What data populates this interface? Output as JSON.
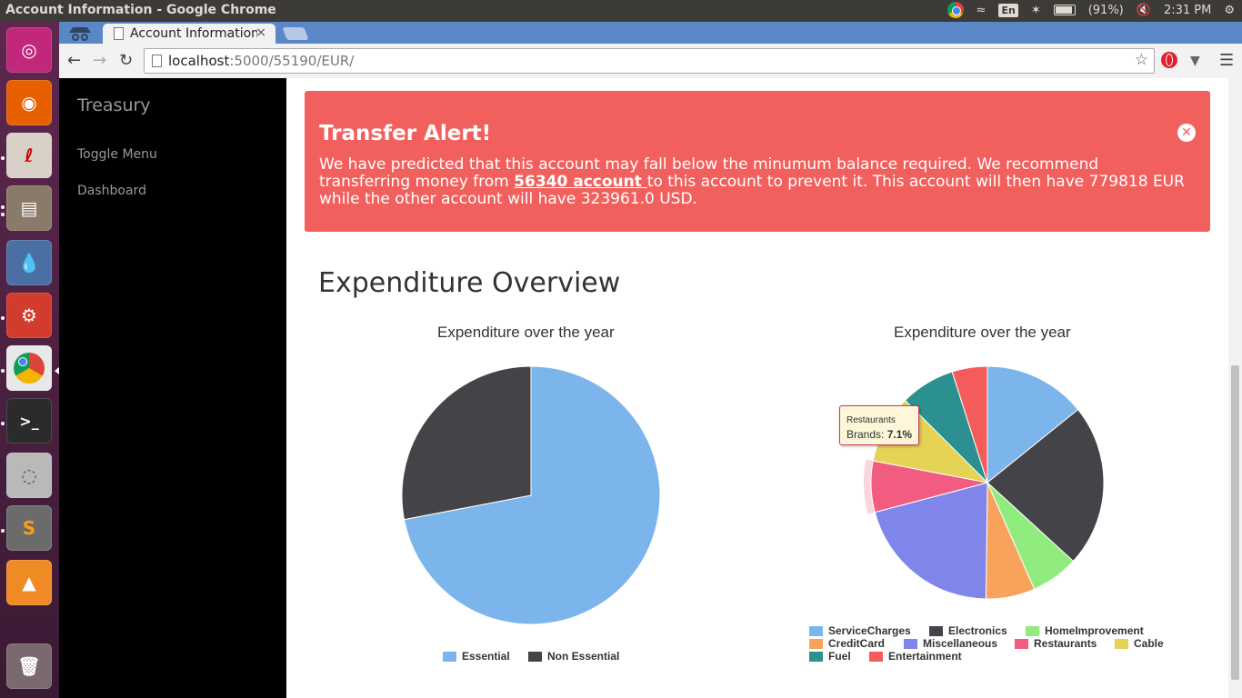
{
  "window": {
    "title": "Account Information - Google Chrome"
  },
  "topbar": {
    "keyboard": "En",
    "battery": "(91%)",
    "clock": "2:31 PM"
  },
  "browser": {
    "tab_title": "Account Information",
    "tab_close": "×",
    "url_host": "localhost",
    "url_rest": ":5000/55190/EUR/"
  },
  "sidebar": {
    "brand": "Treasury",
    "items": [
      {
        "label": "Toggle Menu"
      },
      {
        "label": "Dashboard"
      }
    ]
  },
  "alert": {
    "title": "Transfer Alert!",
    "text_before": "We have predicted that this account may fall below the minumum balance required. We recommend transferring money from ",
    "link": "56340 account ",
    "text_after": "to this account to prevent it. This account will then have 779818 EUR while the other account will have 323961.0 USD.",
    "close": "✕"
  },
  "section": {
    "title": "Expenditure Overview"
  },
  "tooltip": {
    "category": "Restaurants",
    "label": "Brands: ",
    "value": "7.1%"
  },
  "chart_data": [
    {
      "type": "pie",
      "title": "Expenditure over the year",
      "labels": [
        "Essential",
        "Non Essential"
      ],
      "values": [
        72,
        28
      ],
      "colors": [
        "#7cb5ec",
        "#434348"
      ],
      "legend": "bottom"
    },
    {
      "type": "pie",
      "title": "Expenditure over the year",
      "labels": [
        "ServiceCharges",
        "Electronics",
        "HomeImprovement",
        "CreditCard",
        "Miscellaneous",
        "Restaurants",
        "Cable",
        "Fuel",
        "Entertainment"
      ],
      "values": [
        14.2,
        22.6,
        6.6,
        6.8,
        20.7,
        7.1,
        9.5,
        7.6,
        4.9
      ],
      "colors": [
        "#7cb5ec",
        "#434348",
        "#90ed7d",
        "#f7a35c",
        "#8085e9",
        "#f15c80",
        "#e4d354",
        "#2b908f",
        "#f45b5b"
      ],
      "legend": "bottom"
    }
  ]
}
